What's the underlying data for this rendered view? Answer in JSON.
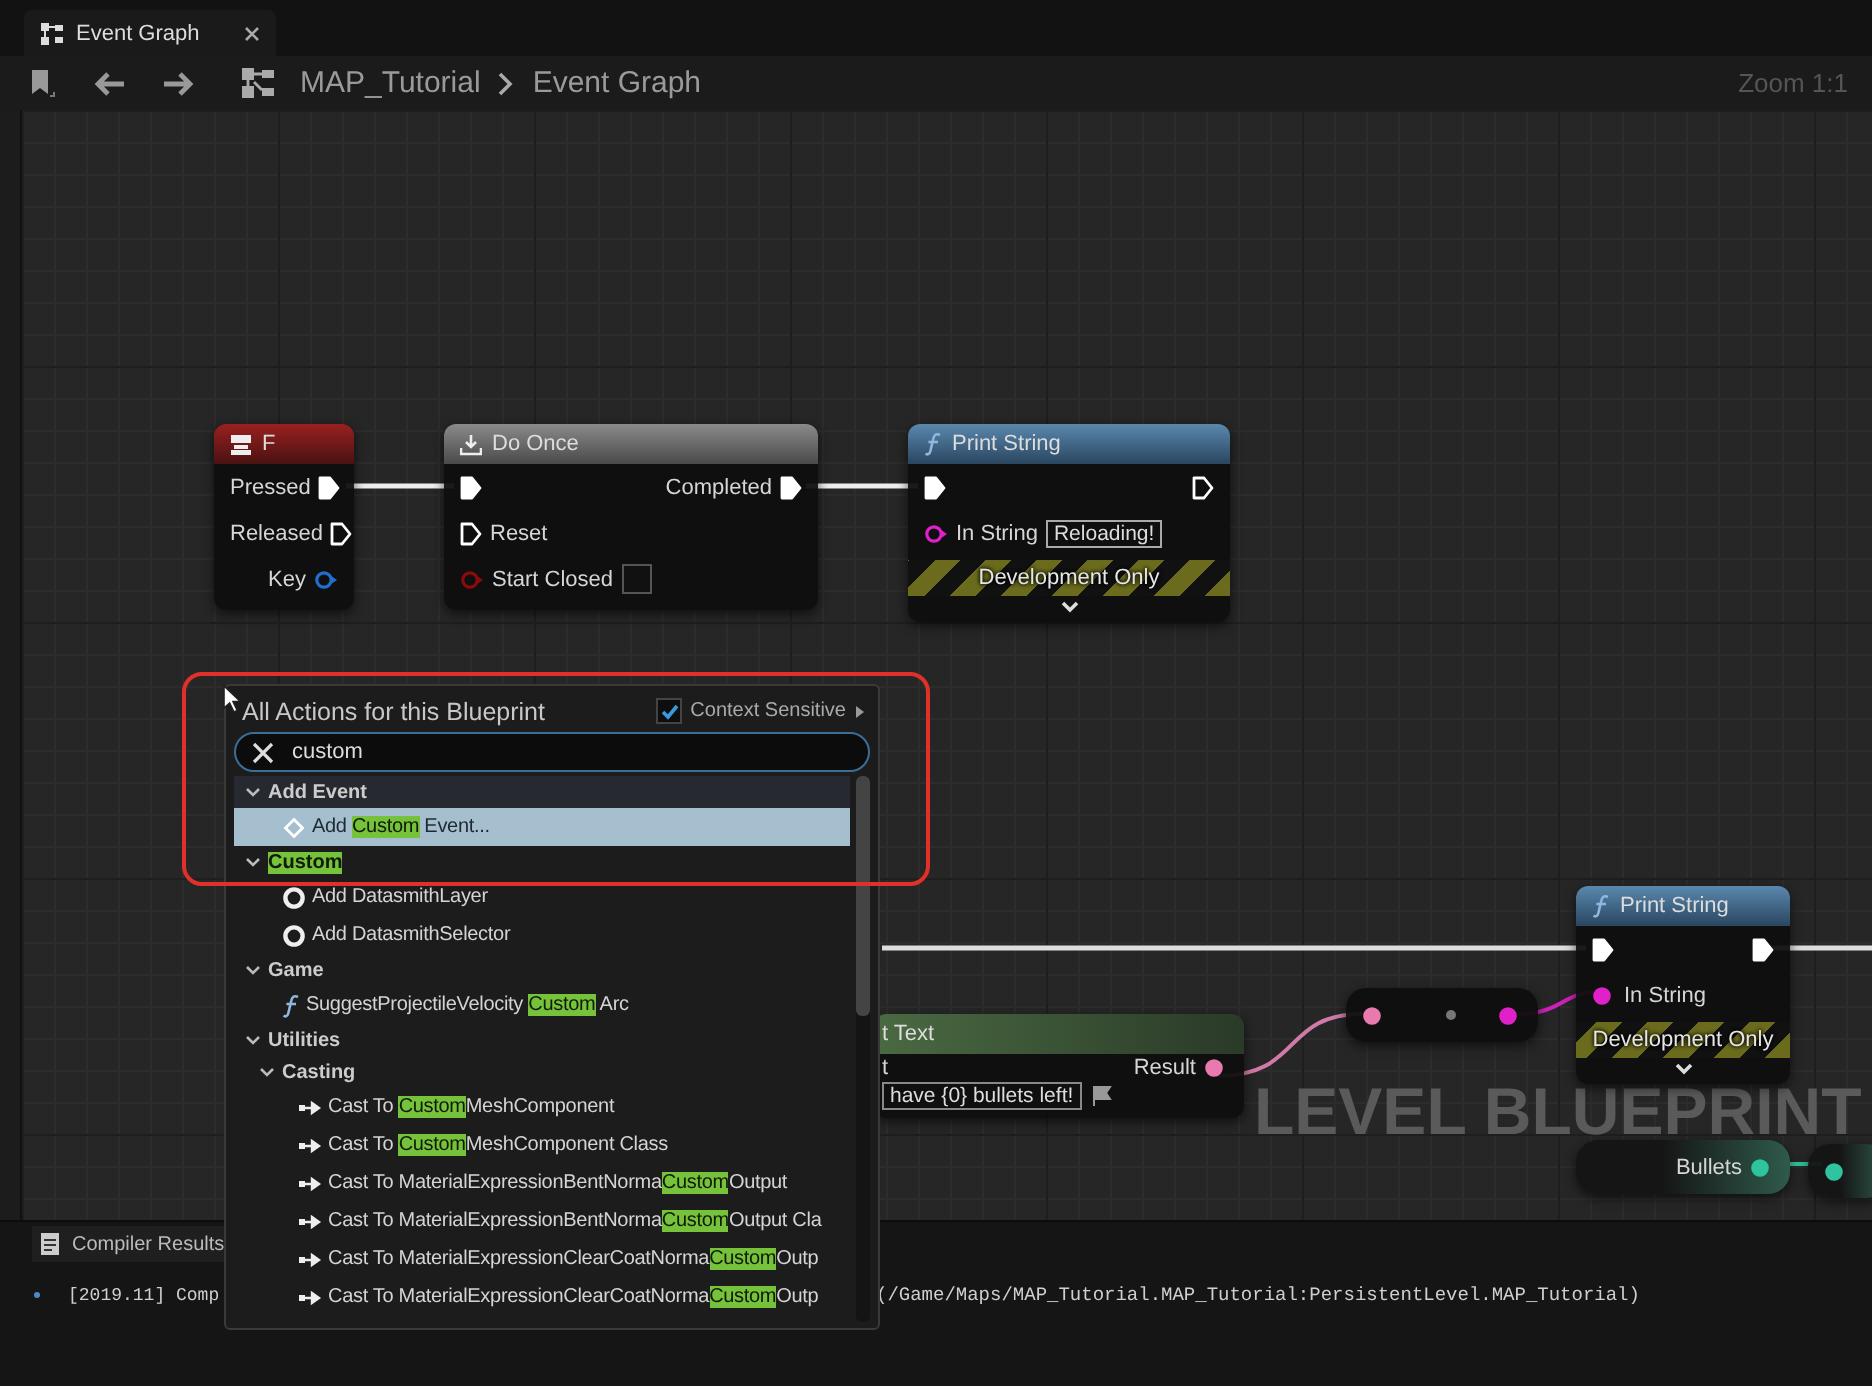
{
  "tab": {
    "title": "Event Graph"
  },
  "breadcrumb": [
    "MAP_Tutorial",
    "Event Graph"
  ],
  "zoom": "Zoom 1:1",
  "graph": {
    "watermark": "LEVEL BLUEPRINT",
    "nodes": [
      {
        "kind": "event",
        "title": "F",
        "rows": [
          {
            "out": {
              "kind": "exec",
              "label": "Pressed",
              "connected": true
            }
          },
          {
            "out": {
              "kind": "exec",
              "label": "Released",
              "connected": false
            }
          },
          {
            "out": {
              "kind": "data",
              "label": "Key",
              "color": "#1f6fd1",
              "connected": false
            }
          }
        ]
      },
      {
        "kind": "macro",
        "title": "Do Once",
        "rows": [
          {
            "in": {
              "kind": "exec",
              "connected": true
            },
            "out": {
              "kind": "exec",
              "label": "Completed",
              "connected": true
            }
          },
          {
            "in": {
              "kind": "exec",
              "label": "Reset",
              "connected": false
            }
          },
          {
            "in": {
              "kind": "data",
              "label": "Start Closed",
              "color": "#8b0a0a",
              "connected": false,
              "checked": false
            }
          }
        ]
      },
      {
        "kind": "function",
        "title": "Print String",
        "dev_only": "Development Only",
        "expandable": true,
        "rows": [
          {
            "in": {
              "kind": "exec",
              "connected": true
            },
            "out": {
              "kind": "exec",
              "connected": false
            }
          },
          {
            "in": {
              "kind": "data",
              "label": "In String",
              "color": "#e020c8",
              "connected": false,
              "value": "Reloading!"
            }
          }
        ]
      },
      {
        "kind": "function",
        "title": "Print String",
        "dev_only": "Development Only",
        "expandable": true,
        "rows": [
          {
            "in": {
              "kind": "exec",
              "connected": true
            },
            "out": {
              "kind": "exec",
              "connected": true
            }
          },
          {
            "in": {
              "kind": "data",
              "label": "In String",
              "color": "#e020c8",
              "connected": true
            }
          }
        ]
      },
      {
        "kind": "conversion",
        "rows": [
          {
            "in": {
              "kind": "data",
              "color": "#e87ab0",
              "connected": true
            },
            "out": {
              "kind": "data",
              "color": "#e020c8",
              "connected": true
            }
          }
        ]
      },
      {
        "kind": "pure",
        "title": "t Text",
        "rows": [
          {
            "in": {
              "kind": "label",
              "label": "t"
            },
            "out": {
              "kind": "data",
              "label": "Result",
              "color": "#e87ab0",
              "connected": true
            }
          },
          {
            "in": {
              "kind": "text_box",
              "value": "have {0} bullets left!"
            }
          }
        ]
      },
      {
        "kind": "variable",
        "rows": [
          {
            "out": {
              "kind": "data",
              "label": "Bullets",
              "color": "#2ec4a0",
              "connected": true
            }
          }
        ]
      },
      {
        "kind": "variable",
        "rows": [
          {
            "in": {
              "kind": "data",
              "color": "#2ec4a0",
              "connected": true
            }
          }
        ]
      }
    ]
  },
  "action_menu": {
    "title": "All Actions for this Blueprint",
    "context_sensitive": {
      "label": "Context Sensitive",
      "checked": true
    },
    "search": {
      "value": "custom"
    },
    "items": [
      {
        "kind": "category",
        "label": [
          {
            "text": "Add Event",
            "match": false
          }
        ],
        "expanded": true,
        "children": [
          {
            "kind": "event",
            "label": [
              {
                "text": "Add ",
                "match": false
              },
              {
                "text": "Custom",
                "match": true
              },
              {
                "text": " Event...",
                "match": false
              }
            ],
            "selected": true
          }
        ]
      },
      {
        "kind": "category",
        "label": [
          {
            "text": "Custom",
            "match": true
          }
        ],
        "expanded": true,
        "children": [
          {
            "kind": "node",
            "label": [
              {
                "text": "Add DatasmithLayer",
                "match": false
              }
            ],
            "selected": false
          },
          {
            "kind": "node",
            "label": [
              {
                "text": "Add DatasmithSelector",
                "match": false
              }
            ],
            "selected": false
          }
        ]
      },
      {
        "kind": "category",
        "label": [
          {
            "text": "Game",
            "match": false
          }
        ],
        "expanded": true,
        "children": [
          {
            "kind": "function",
            "label": [
              {
                "text": "SuggestProjectileVelocity ",
                "match": false
              },
              {
                "text": "Custom",
                "match": true
              },
              {
                "text": " Arc",
                "match": false
              }
            ],
            "selected": false
          }
        ]
      },
      {
        "kind": "category",
        "label": [
          {
            "text": "Utilities",
            "match": false
          }
        ],
        "expanded": true,
        "children": [
          {
            "kind": "category",
            "label": [
              {
                "text": "Casting",
                "match": false
              }
            ],
            "expanded": true,
            "children": [
              {
                "kind": "cast",
                "label": [
                  {
                    "text": "Cast To ",
                    "match": false
                  },
                  {
                    "text": "Custom",
                    "match": true
                  },
                  {
                    "text": "MeshComponent",
                    "match": false
                  }
                ],
                "selected": false
              },
              {
                "kind": "cast",
                "label": [
                  {
                    "text": "Cast To ",
                    "match": false
                  },
                  {
                    "text": "Custom",
                    "match": true
                  },
                  {
                    "text": "MeshComponent Class",
                    "match": false
                  }
                ],
                "selected": false
              },
              {
                "kind": "cast",
                "label": [
                  {
                    "text": "Cast To MaterialExpressionBentNorma",
                    "match": false
                  },
                  {
                    "text": "Custom",
                    "match": true
                  },
                  {
                    "text": "Output",
                    "match": false
                  }
                ],
                "selected": false
              },
              {
                "kind": "cast",
                "label": [
                  {
                    "text": "Cast To MaterialExpressionBentNorma",
                    "match": false
                  },
                  {
                    "text": "Custom",
                    "match": true
                  },
                  {
                    "text": "Output Cla",
                    "match": false
                  }
                ],
                "selected": false
              },
              {
                "kind": "cast",
                "label": [
                  {
                    "text": "Cast To MaterialExpressionClearCoatNorma",
                    "match": false
                  },
                  {
                    "text": "Custom",
                    "match": true
                  },
                  {
                    "text": "Outp",
                    "match": false
                  }
                ],
                "selected": false
              },
              {
                "kind": "cast",
                "label": [
                  {
                    "text": "Cast To MaterialExpressionClearCoatNorma",
                    "match": false
                  },
                  {
                    "text": "Custom",
                    "match": true
                  },
                  {
                    "text": "Outp",
                    "match": false
                  }
                ],
                "selected": false
              }
            ]
          }
        ]
      }
    ]
  },
  "compiler_results": {
    "title": "Compiler Results",
    "log": [
      "[2019.11] Comp",
      "(/Game/Maps/MAP_Tutorial.MAP_Tutorial:PersistentLevel.MAP_Tutorial)"
    ]
  }
}
